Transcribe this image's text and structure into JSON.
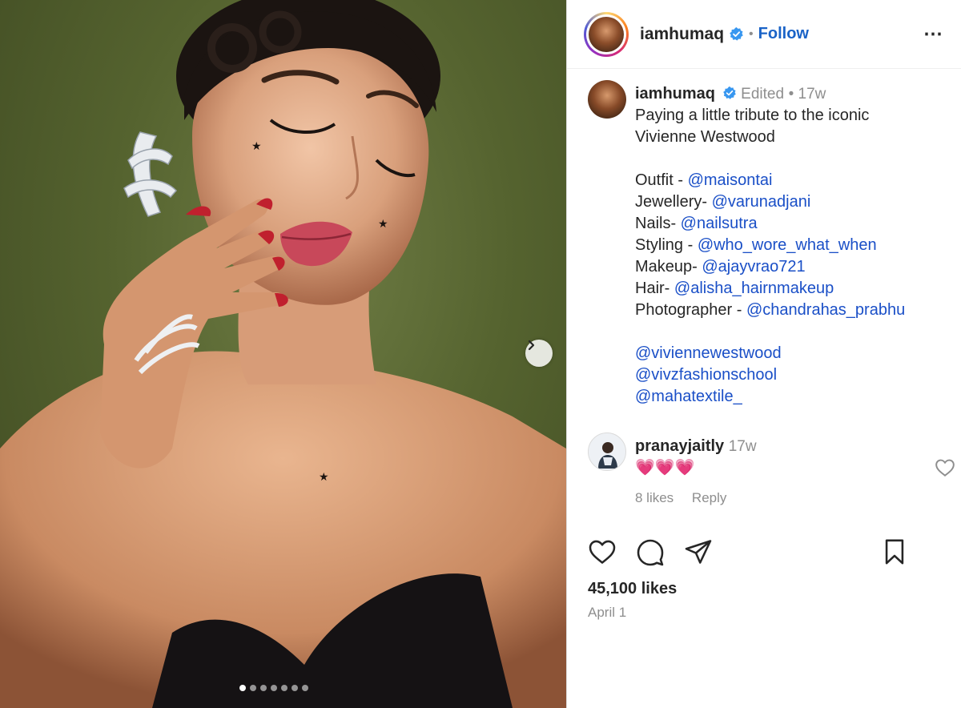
{
  "post": {
    "username": "iamhumaq",
    "follow_label": "Follow",
    "more_icon": "⋯"
  },
  "caption": {
    "username": "iamhumaq",
    "edited": "Edited",
    "time": "17w",
    "text_lines": [
      "Paying a little tribute to the iconic",
      "Vivienne Westwood"
    ],
    "credits": [
      {
        "label": "Outfit - ",
        "mention": "@maisontai"
      },
      {
        "label": "Jewellery- ",
        "mention": "@varunadjani"
      },
      {
        "label": "Nails- ",
        "mention": "@nailsutra"
      },
      {
        "label": "Styling - ",
        "mention": "@who_wore_what_when"
      },
      {
        "label": "Makeup- ",
        "mention": "@ajayvrao721"
      },
      {
        "label": "Hair- ",
        "mention": "@alisha_hairnmakeup"
      },
      {
        "label": "Photographer - ",
        "mention": "@chandrahas_prabhu"
      }
    ],
    "tags": [
      "@viviennewestwood",
      "@vivzfashionschool",
      "@mahatextile_"
    ]
  },
  "comment": {
    "username": "pranayjaitly",
    "time": "17w",
    "text": "💗💗💗",
    "likes": "8 likes",
    "reply_label": "Reply"
  },
  "stats": {
    "likes": "45,100 likes",
    "date": "April 1"
  },
  "carousel": {
    "total": 7,
    "active_index": 0
  },
  "colors": {
    "verified": "#3897f0",
    "link": "#1a4fc7",
    "follow": "#1a63c7"
  }
}
